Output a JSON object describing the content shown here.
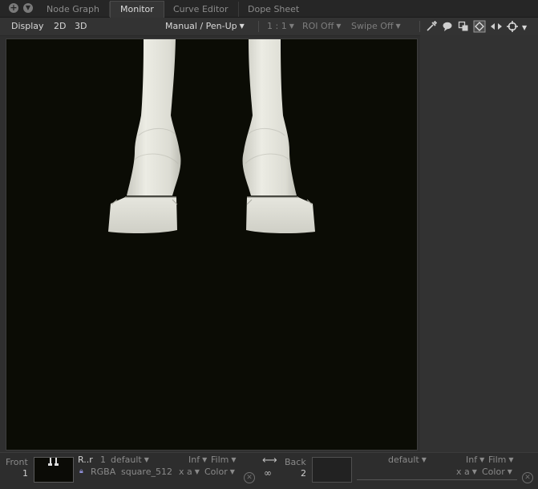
{
  "tabs": [
    {
      "label": "Node Graph",
      "active": false
    },
    {
      "label": "Monitor",
      "active": true
    },
    {
      "label": "Curve Editor",
      "active": false
    },
    {
      "label": "Dope Sheet",
      "active": false
    }
  ],
  "toolbar": {
    "display": "Display",
    "mode_2d": "2D",
    "mode_3d": "3D",
    "pen_mode": "Manual / Pen-Up",
    "zoom": "1 : 1",
    "roi": "ROI Off",
    "swipe": "Swipe Off",
    "icons": [
      "eyedropper-icon",
      "speech-bubble-icon",
      "overlay-layers-icon",
      "view-frame-icon",
      "sync-icon",
      "target-icon",
      "menu-icon"
    ]
  },
  "viewer": {
    "background": "#0b0c05",
    "subject": "two horse legs with hooves, front view",
    "leg_color": "#e4e4dc"
  },
  "bottom": {
    "front_label": "Front",
    "front_num": "1",
    "a_name": "R..r",
    "a_frame": "1",
    "a_default": "default",
    "a_lock_icon": "lock-icon",
    "a_channels": "RGBA",
    "a_format": "square_512",
    "a_inf": "Inf",
    "a_film": "Film",
    "a_xa": "x a",
    "a_color": "Color",
    "back_label": "Back",
    "back_num": "2",
    "b_default": "default",
    "b_inf": "Inf",
    "b_film": "Film",
    "b_xa": "x a",
    "b_color": "Color"
  }
}
